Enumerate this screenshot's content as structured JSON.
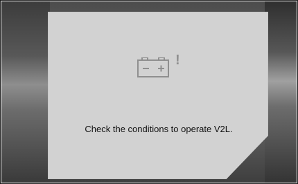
{
  "panel": {
    "icon": "battery-icon",
    "warning_mark": "!",
    "message": "Check the conditions to operate V2L."
  },
  "colors": {
    "panel_background": "#d2d2d2",
    "message_text": "#111111",
    "icon_color": "#8f8f8f",
    "screen_background": "#5a5a5a"
  }
}
